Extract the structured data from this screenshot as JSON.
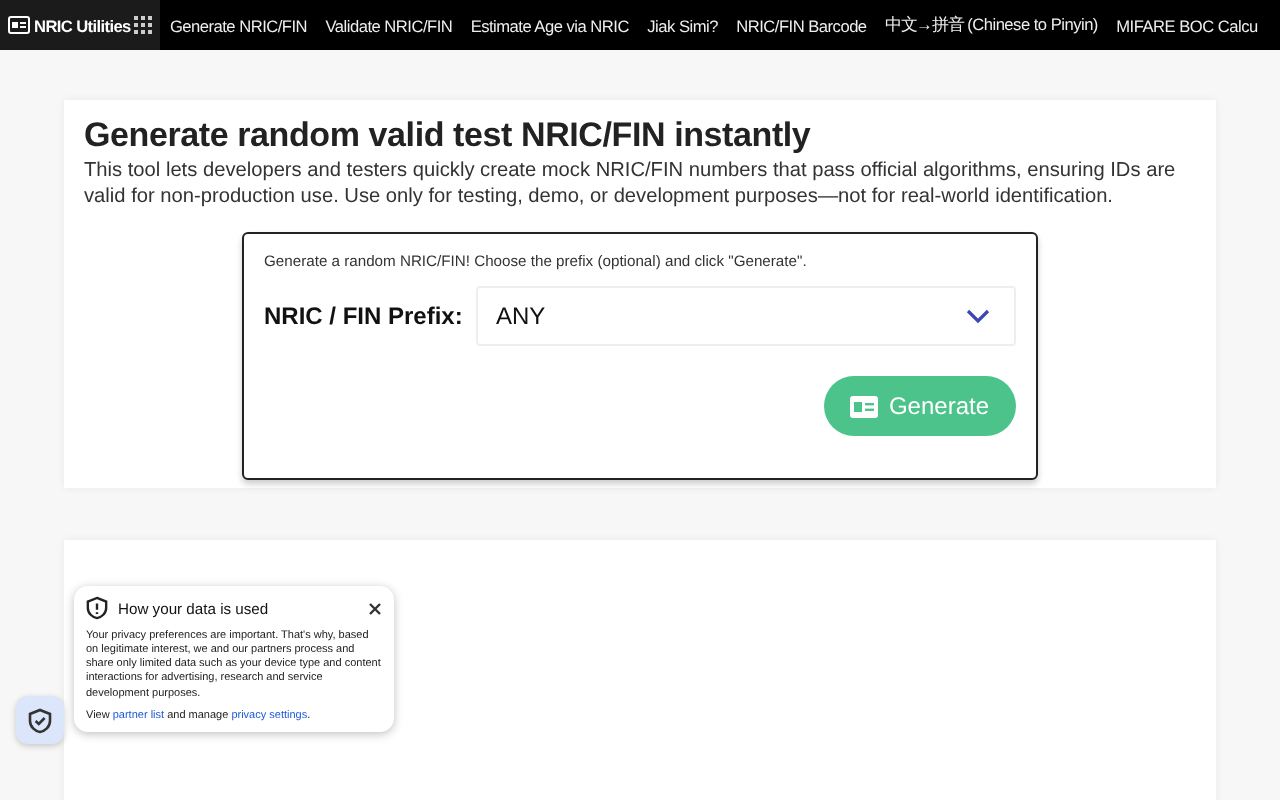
{
  "nav": {
    "brand": "NRIC Utilities",
    "items": [
      "Generate NRIC/FIN",
      "Validate NRIC/FIN",
      "Estimate Age via NRIC",
      "Jiak Simi?",
      "NRIC/FIN Barcode",
      "中文→拼音 (Chinese to Pinyin)",
      "MIFARE BOC Calcu"
    ]
  },
  "hero": {
    "title": "Generate random valid test NRIC/FIN instantly",
    "description": "This tool lets developers and testers quickly create mock NRIC/FIN numbers that pass official algorithms, ensuring IDs are valid for non-production use. Use only for testing, demo, or development purposes—not for real-world identification."
  },
  "generator": {
    "hint": "Generate a random NRIC/FIN! Choose the prefix (optional) and click \"Generate\".",
    "prefix_label": "NRIC / FIN Prefix:",
    "prefix_value": "ANY",
    "button": "Generate"
  },
  "privacy": {
    "title": "How your data is used",
    "body": "Your privacy preferences are important. That's why, based on legitimate interest, we and our partners process and share only limited data such as your device type and content interactions for advertising, research and service development purposes.",
    "footer_before": "View",
    "link1": "partner list",
    "footer_middle": "and manage",
    "link2": "privacy settings",
    "footer_after": "."
  }
}
